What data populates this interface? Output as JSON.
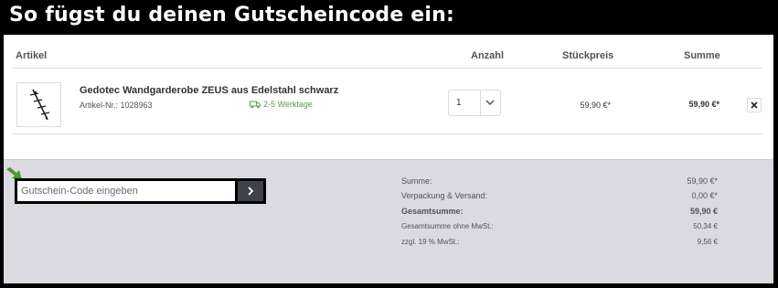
{
  "banner": {
    "title": "So fügst du deinen Gutscheincode ein:"
  },
  "cart": {
    "columns": {
      "article": "Artikel",
      "quantity": "Anzahl",
      "unit_price": "Stückpreis",
      "total": "Summe"
    },
    "item": {
      "name": "Gedotec Wandgarderobe ZEUS aus Edelstahl schwarz",
      "sku": "Artikel-Nr.: 1028963",
      "delivery": "2-5 Werktage",
      "quantity": "1",
      "unit_price": "59,90 €*",
      "total": "59,90 €*"
    }
  },
  "voucher": {
    "placeholder": "Gutschein-Code eingeben"
  },
  "summary": {
    "rows": [
      {
        "label": "Summe:",
        "value": "59,90 €*"
      },
      {
        "label": "Verpackung & Versand:",
        "value": "0,00 €*"
      },
      {
        "label": "Gesamtsumme:",
        "value": "59,90 €"
      },
      {
        "label": "Gesamtsumme ohne MwSt.:",
        "value": "50,34 €"
      },
      {
        "label": "zzgl. 19 % MwSt.:",
        "value": "9,56 €"
      }
    ]
  },
  "icons": {
    "pointer": "green-arrow-icon",
    "delivery": "truck-icon",
    "quantity": "chevron-down-icon",
    "remove": "close-icon",
    "submit": "chevron-right-icon"
  },
  "colors": {
    "arrow": "#4a9a2e",
    "delivery_text": "#5a9e49",
    "footer_bg": "#dadae0",
    "button_bg": "#3f4248"
  }
}
